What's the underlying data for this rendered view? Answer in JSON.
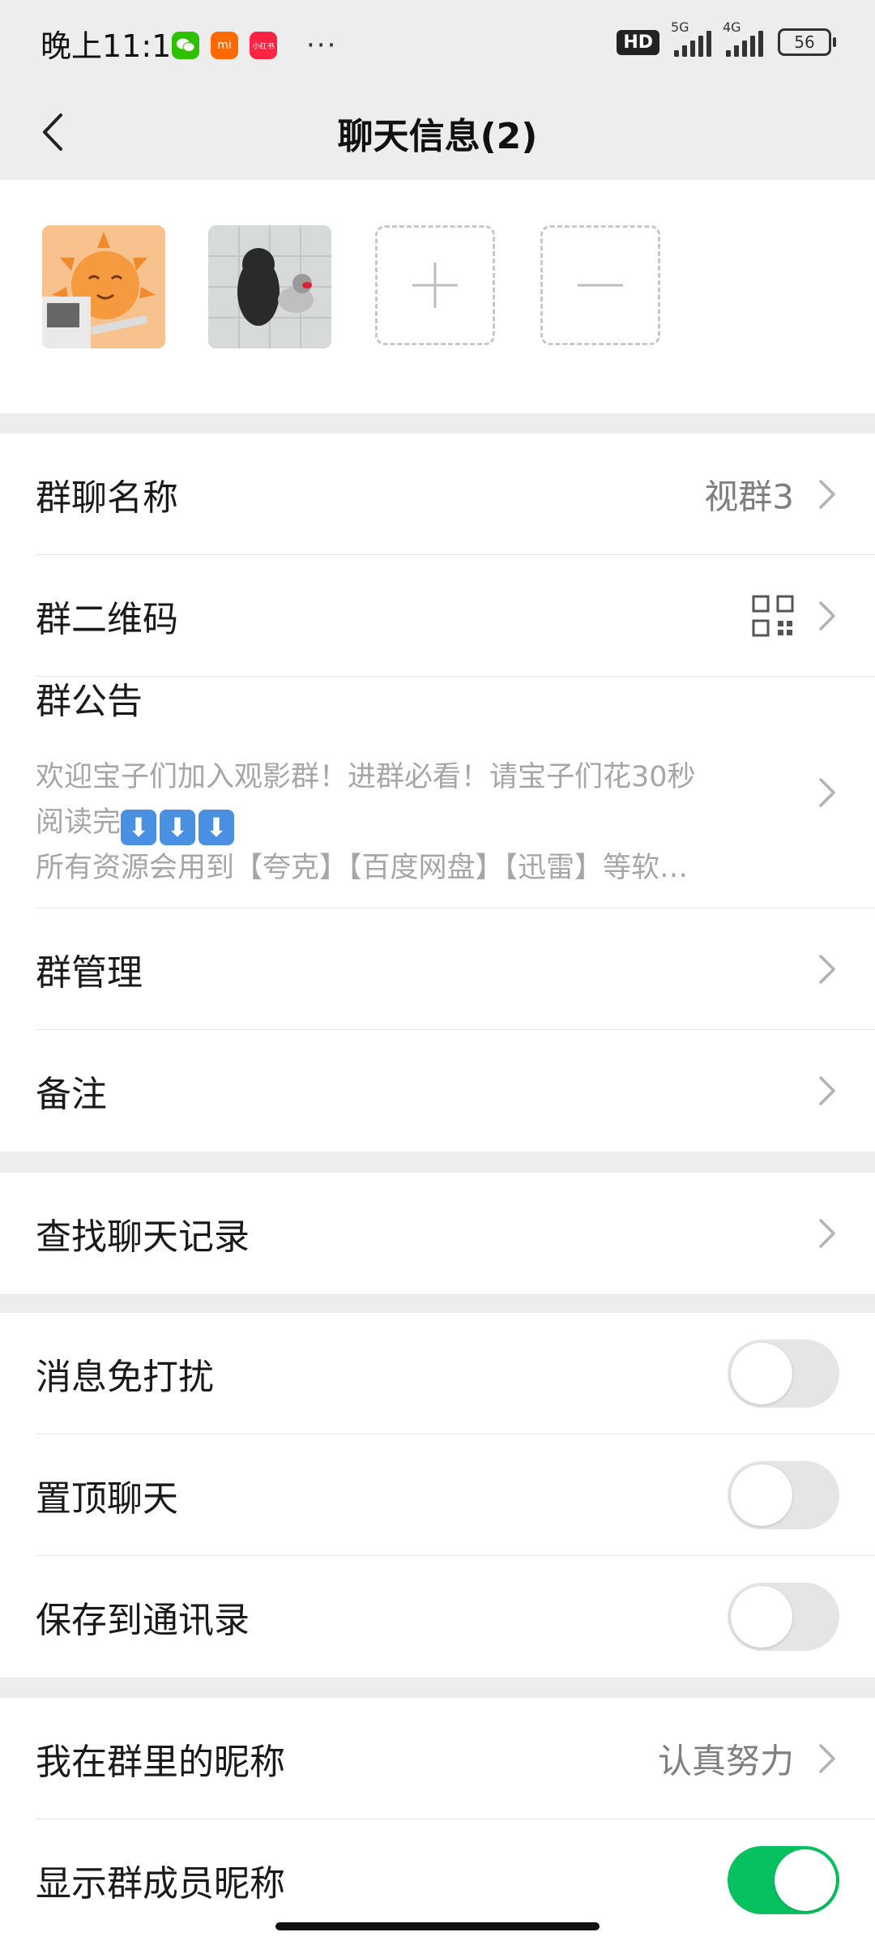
{
  "status": {
    "time": "晚上11:14",
    "app_icons": [
      "wechat-icon",
      "mi-icon",
      "xiaohongshu-icon"
    ],
    "mi_label": "mi",
    "xhs_label": "小红书",
    "more": "···",
    "hd": "HD",
    "net1": "5G",
    "net2": "4G",
    "battery": "56"
  },
  "nav": {
    "title": "聊天信息(2)"
  },
  "rows": {
    "group_name": {
      "label": "群聊名称",
      "value": "视群3"
    },
    "qr_code": {
      "label": "群二维码"
    },
    "notice": {
      "label": "群公告",
      "line1": "欢迎宝子们加入观影群！进群必看！请宝子们花30秒",
      "line2_prefix": "阅读完",
      "line2_emoji": "⬇",
      "line3": "所有资源会用到【夸克】【百度网盘】【迅雷】等软…"
    },
    "manage": {
      "label": "群管理"
    },
    "remark": {
      "label": "备注"
    },
    "search": {
      "label": "查找聊天记录"
    },
    "mute": {
      "label": "消息免打扰",
      "on": false
    },
    "pin": {
      "label": "置顶聊天",
      "on": false
    },
    "save_contacts": {
      "label": "保存到通讯录",
      "on": false
    },
    "nickname": {
      "label": "我在群里的昵称",
      "value": "认真努力"
    },
    "show_nicknames": {
      "label": "显示群成员昵称",
      "on": true
    }
  },
  "colors": {
    "accent_green": "#07c160",
    "background": "#ededed"
  }
}
